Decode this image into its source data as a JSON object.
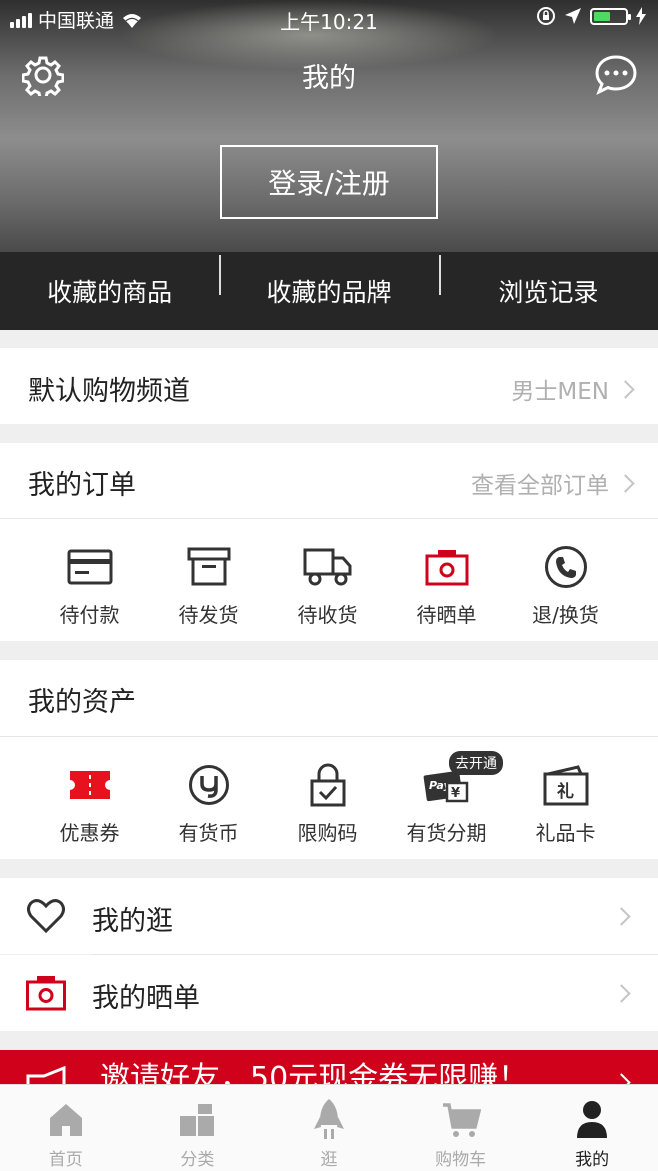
{
  "status_bar": {
    "carrier": "中国联通",
    "time": "上午10:21"
  },
  "header": {
    "title": "我的",
    "login_button": "登录/注册"
  },
  "favorites": [
    "收藏的商品",
    "收藏的品牌",
    "浏览记录"
  ],
  "channel": {
    "label": "默认购物频道",
    "value": "男士MEN"
  },
  "orders": {
    "title": "我的订单",
    "link": "查看全部订单",
    "items": [
      {
        "label": "待付款",
        "icon": "card-icon"
      },
      {
        "label": "待发货",
        "icon": "box-icon"
      },
      {
        "label": "待收货",
        "icon": "truck-icon"
      },
      {
        "label": "待晒单",
        "icon": "camera-icon"
      },
      {
        "label": "退/换货",
        "icon": "phone-icon"
      }
    ]
  },
  "assets": {
    "title": "我的资产",
    "items": [
      {
        "label": "优惠券",
        "icon": "coupon-icon"
      },
      {
        "label": "有货币",
        "icon": "coin-icon"
      },
      {
        "label": "限购码",
        "icon": "lock-icon"
      },
      {
        "label": "有货分期",
        "icon": "pay-icon",
        "badge": "去开通"
      },
      {
        "label": "礼品卡",
        "icon": "gift-card-icon"
      }
    ]
  },
  "list": [
    {
      "label": "我的逛",
      "icon": "heart-icon"
    },
    {
      "label": "我的晒单",
      "icon": "camera-icon"
    }
  ],
  "promo": {
    "text": "邀请好友，50元现金券无限赚！"
  },
  "tabbar": [
    {
      "label": "首页",
      "icon": "home-icon",
      "active": false
    },
    {
      "label": "分类",
      "icon": "category-icon",
      "active": false
    },
    {
      "label": "逛",
      "icon": "rocket-icon",
      "active": false
    },
    {
      "label": "购物车",
      "icon": "cart-icon",
      "active": false
    },
    {
      "label": "我的",
      "icon": "user-icon",
      "active": true
    }
  ],
  "colors": {
    "accent": "#d0021b",
    "dark_bar": "#262626",
    "battery": "#4cd964"
  }
}
